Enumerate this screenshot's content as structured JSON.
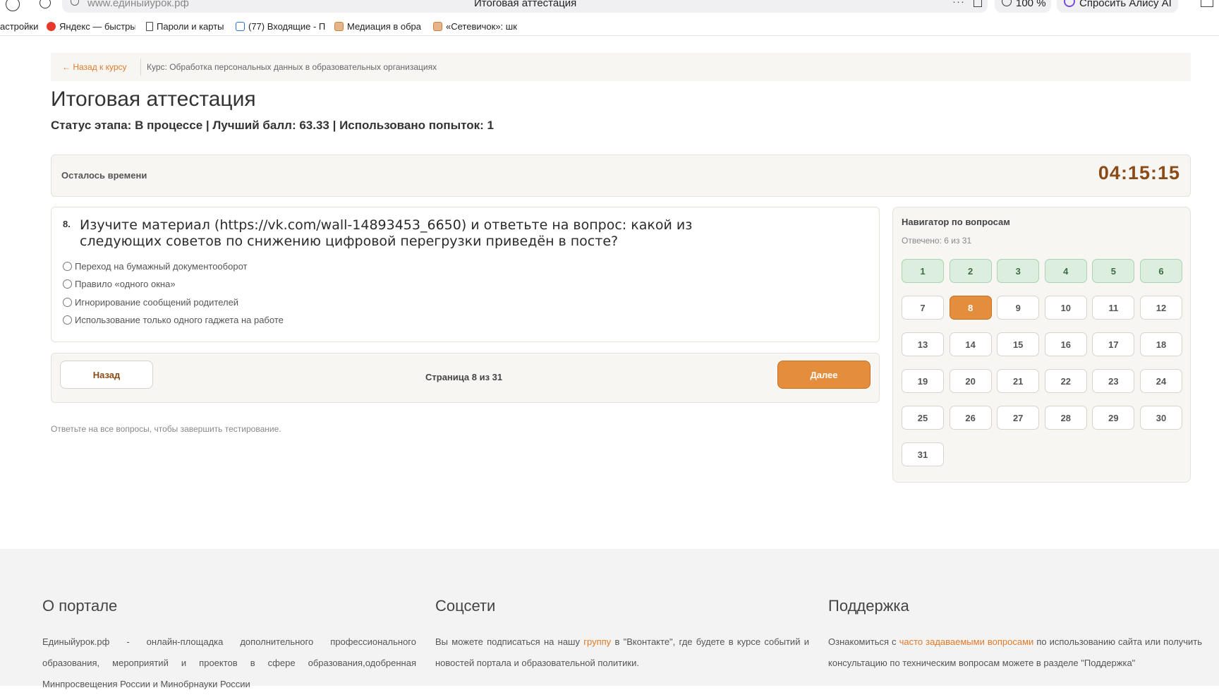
{
  "browser": {
    "url": "www.единыйурок.рф",
    "tab_title": "Итоговая аттестация",
    "zoom": "100 %",
    "alice": "Спросить Алису AI",
    "bookmarks": [
      {
        "label": "астройки",
        "icon": "gear-icon",
        "color": "#888888"
      },
      {
        "label": "Яндекс — быстрый",
        "icon": "yandex-icon",
        "color": "#e6392c"
      },
      {
        "label": "Пароли и карты",
        "icon": "document-icon",
        "color": "#444444"
      },
      {
        "label": "(77) Входящие - П",
        "icon": "mail-icon",
        "color": "#2a6fd6"
      },
      {
        "label": "Медиация в обра",
        "icon": "book-icon",
        "color": "#c8823c"
      },
      {
        "label": "«Сетевичок»: шк",
        "icon": "book-icon",
        "color": "#c8823c"
      }
    ]
  },
  "breadcrumb": {
    "back": "← Назад к курсу",
    "course": "Курс: Обработка персональных данных в образовательных организациях"
  },
  "page": {
    "title": "Итоговая аттестация",
    "status": "Статус этапа: В процессе | Лучший балл: 63.33 | Использовано попыток: 1"
  },
  "timer": {
    "label": "Осталось времени",
    "value": "04:15:15"
  },
  "question": {
    "number": "8.",
    "text": "Изучите материал (https://vk.com/wall-14893453_6650) и ответьте на вопрос: какой из следующих советов по снижению цифровой перегрузки приведён в посте?",
    "options": [
      "Переход на бумажный документооборот",
      "Правило «одного окна»",
      "Игнорирование сообщений родителей",
      "Использование только одного гаджета на работе"
    ]
  },
  "pager": {
    "back": "Назад",
    "info": "Страница 8 из 31",
    "next": "Далее"
  },
  "hint": "Ответьте на все вопросы, чтобы завершить тестирование.",
  "navigator": {
    "title": "Навигатор по вопросам",
    "answered": "Отвечено: 6 из 31",
    "current": 8,
    "answered_numbers": [
      1,
      2,
      3,
      4,
      5,
      6
    ],
    "total": 31,
    "colors": {
      "answered": "#dcefdf",
      "current": "#e48d3c"
    }
  },
  "footer": {
    "about": {
      "title": "О портале",
      "text": "Единыйурок.рф - онлайн-площадка дополнительного профессионального образования, мероприятий и проектов в сфере образования,одобренная Минпросвещения России и Минобрнауки России"
    },
    "social": {
      "title": "Соцсети",
      "text_before": "Вы можете подписаться на нашу ",
      "link": "группу",
      "text_after": " в \"Вконтакте\", где будете в курсе событий и новостей портала и образовательной политики."
    },
    "support": {
      "title": "Поддержка",
      "text_before": "Ознакомиться с ",
      "link": "часто задаваемыми вопросами",
      "text_after": " по использованию сайта или получить консультацию по техническим вопросам можете в разделе \"Поддержка\""
    }
  }
}
